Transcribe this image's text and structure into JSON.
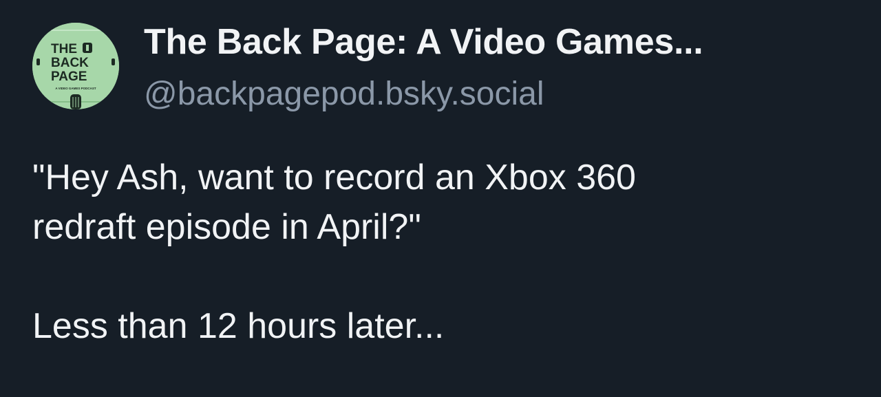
{
  "post": {
    "author": {
      "display_name": "The Back Page: A Video Games...",
      "handle": "@backpagepod.bsky.social",
      "avatar": {
        "line1": "THE",
        "line2": "BACK",
        "line3": "PAGE",
        "tagline": "A VIDEO GAMES PODCAST",
        "background_color": "#a7d7a9"
      }
    },
    "text_lines": [
      "\"Hey Ash, want to record an Xbox 360",
      "redraft episode in April?\"",
      "Less than 12 hours later..."
    ]
  },
  "colors": {
    "background": "#161e27",
    "text": "#f1f3f5",
    "handle": "#8b98a8"
  }
}
